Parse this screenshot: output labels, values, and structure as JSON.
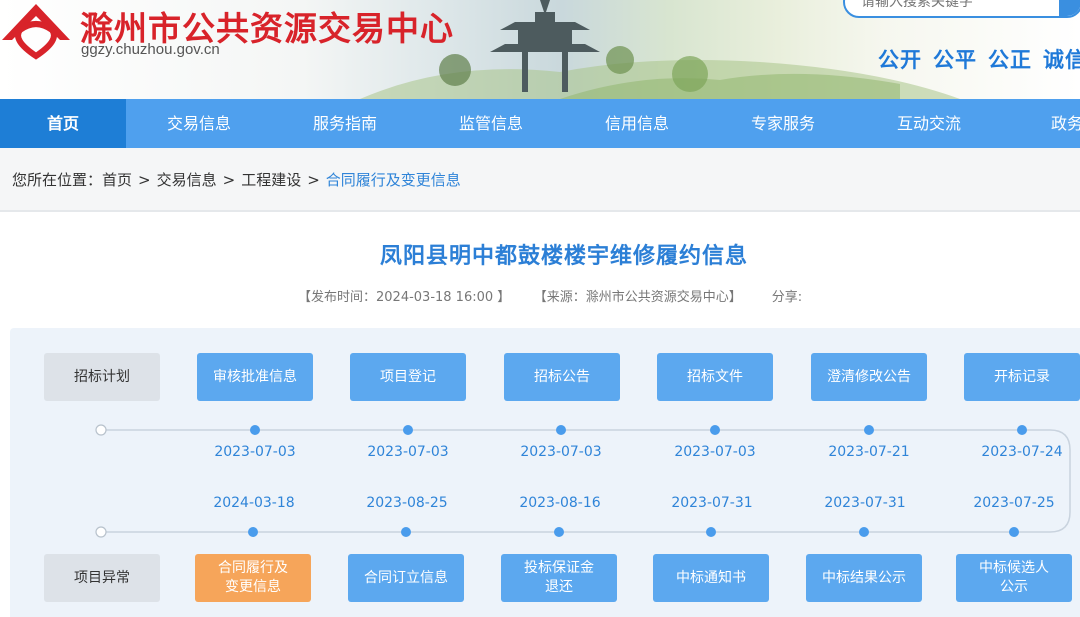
{
  "header": {
    "site_title": "滁州市公共资源交易中心",
    "site_domain": "ggzy.chuzhou.gov.cn",
    "search_placeholder": "请输入搜索关键字",
    "slogan": [
      "公开",
      "公平",
      "公正",
      "诚信"
    ],
    "colors": {
      "title_red": "#d8232a",
      "brand_blue": "#1f79d8"
    }
  },
  "nav": {
    "items": [
      "首页",
      "交易信息",
      "服务指南",
      "监管信息",
      "信用信息",
      "专家服务",
      "互动交流",
      "政务信"
    ],
    "active": "首页",
    "colors": {
      "bar": "#4fa0ee",
      "active": "#1e7ed6"
    }
  },
  "breadcrumb": {
    "prefix": "您所在位置：",
    "items": [
      "首页",
      "交易信息",
      "工程建设"
    ],
    "current": "合同履行及变更信息",
    "separator": ">"
  },
  "article": {
    "title": "凤阳县明中都鼓楼楼宇维修履约信息",
    "publish_time": "【发布时间：2024-03-18 16:00 】",
    "source": "【来源：滁州市公共资源交易中心】",
    "share": "分享:"
  },
  "timeline": {
    "top_row_label": "招标计划",
    "bottom_row_label": "项目异常",
    "top_steps": [
      {
        "label": "审核批准信息",
        "date": "2023-07-03"
      },
      {
        "label": "项目登记",
        "date": "2023-07-03"
      },
      {
        "label": "招标公告",
        "date": "2023-07-03"
      },
      {
        "label": "招标文件",
        "date": "2023-07-03"
      },
      {
        "label": "澄清修改公告",
        "date": "2023-07-21"
      },
      {
        "label": "开标记录",
        "date": "2023-07-24"
      }
    ],
    "bottom_steps": [
      {
        "label": "合同履行及变更信息",
        "date": "2024-03-18",
        "active": true
      },
      {
        "label": "合同订立信息",
        "date": "2023-08-25"
      },
      {
        "label": "投标保证金退还",
        "date": "2023-08-16"
      },
      {
        "label": "中标通知书",
        "date": "2023-07-31"
      },
      {
        "label": "中标结果公示",
        "date": "2023-07-31"
      },
      {
        "label": "中标候选人公示",
        "date": "2023-07-25"
      }
    ],
    "colors": {
      "step": "#5ca8ef",
      "active_step": "#f6a55a",
      "dot": "#4a9cec"
    }
  }
}
